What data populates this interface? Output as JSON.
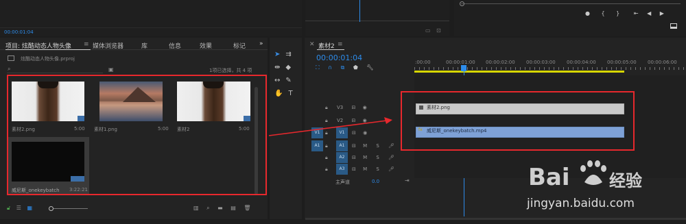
{
  "top": {
    "timecode": "00:00:01:04"
  },
  "project": {
    "tabs": [
      "项目: 炫酷动态人物头像",
      "媒体浏览器",
      "库",
      "信息",
      "效果",
      "标记"
    ],
    "file": "炫酷动态人物头像.prproj",
    "selection_status": "1项已选择，共 4 项",
    "items": [
      {
        "name": "素材2.png",
        "duration": "5:00"
      },
      {
        "name": "素材1.png",
        "duration": "5:00"
      },
      {
        "name": "素材2",
        "duration": "5:00"
      },
      {
        "name": "威尼斯_onekeybatch",
        "duration": "3:22:21"
      }
    ]
  },
  "timeline": {
    "tab": "素材2",
    "timecode": "00:00:01:04",
    "ruler": [
      ":00:00",
      "00:00:01:00",
      "00:00:02:00",
      "00:00:03:00",
      "00:00:04:00",
      "00:00:05:00",
      "00:00:06:00"
    ],
    "tracks": {
      "v3": "V3",
      "v2": "V2",
      "v1_src": "V1",
      "v1": "V1",
      "a1_src": "A1",
      "a1": "A1",
      "a2": "A2",
      "a3": "A3",
      "master": "主声道",
      "master_level": "0.0",
      "m": "M",
      "s": "S"
    },
    "clips": [
      {
        "name": "素材2.png",
        "track": "V2"
      },
      {
        "name": "威尼斯_onekeybatch.mp4",
        "track": "V1",
        "badge": "fx"
      }
    ]
  },
  "watermark": {
    "brand": "Bai 经验",
    "url": "jingyan.baidu.com"
  },
  "colors": {
    "accent": "#2d8ceb",
    "highlight": "#e8282d",
    "v1_clip": "#7ea1d6",
    "v2_clip": "#c9c9c9",
    "work_area": "#d7d700"
  }
}
